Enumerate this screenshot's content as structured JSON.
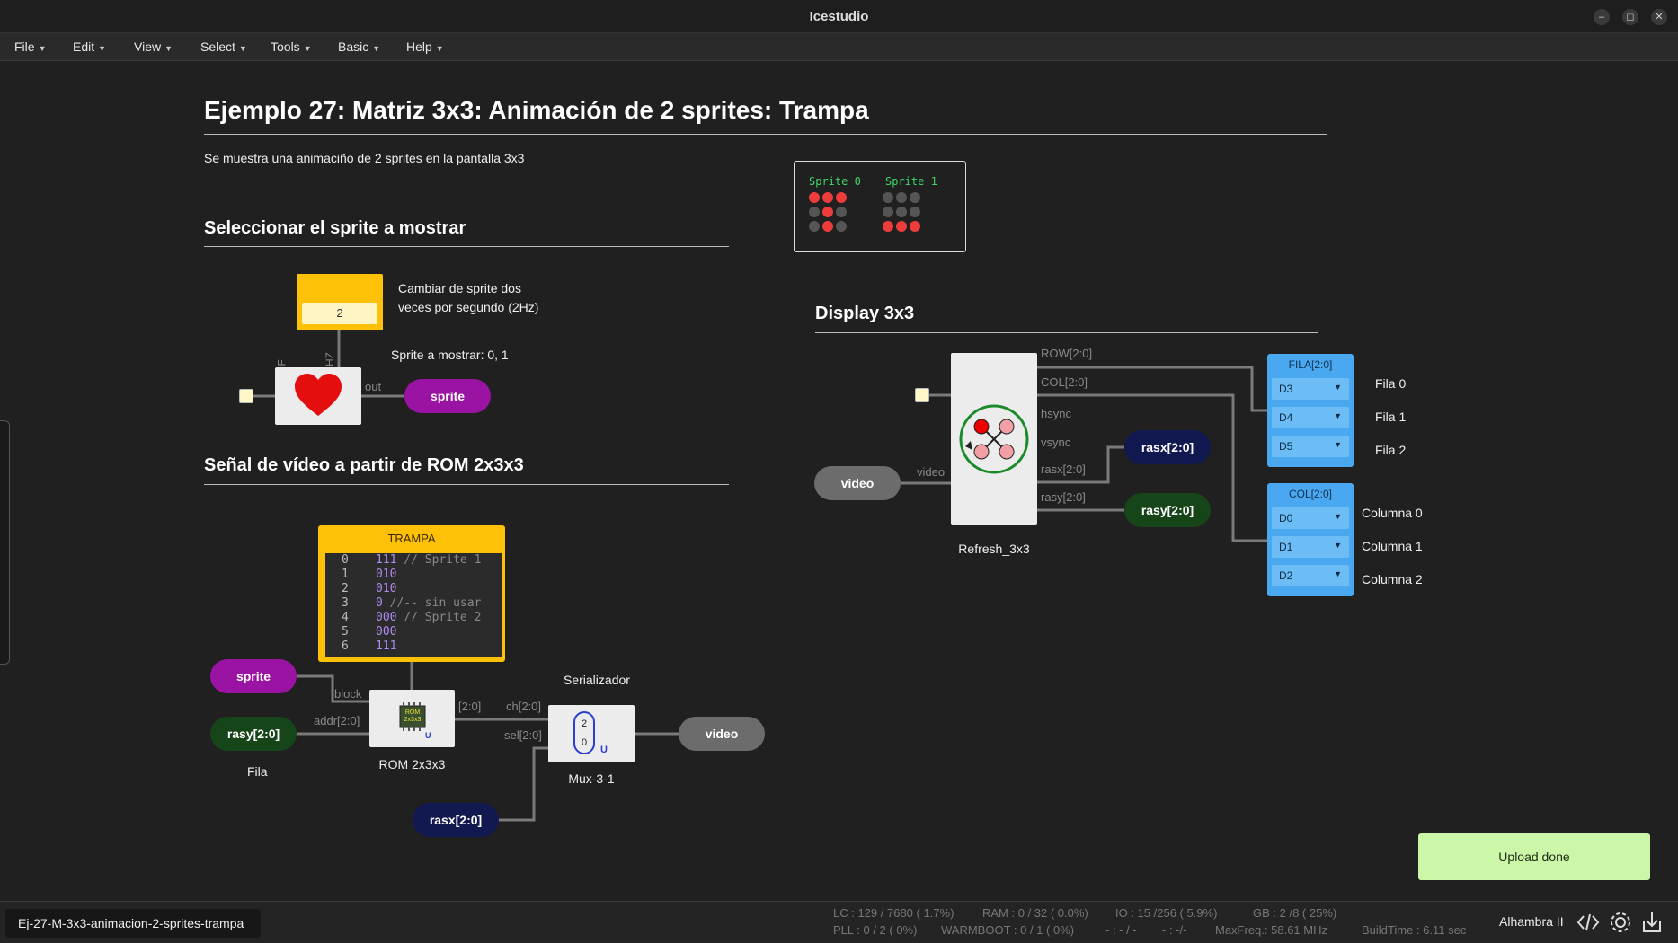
{
  "window": {
    "title": "Icestudio"
  },
  "menu": [
    "File",
    "Edit",
    "View",
    "Select",
    "Tools",
    "Basic",
    "Help"
  ],
  "canvas": {
    "title": "Ejemplo 27: Matriz 3x3: Animación de 2 sprites: Trampa",
    "description": "Se muestra una animaciño de 2 sprites en la pantalla 3x3",
    "section_select": "Seleccionar el sprite a mostrar",
    "section_video": "Señal de vídeo a partir de ROM 2x3x3",
    "section_display": "Display 3x3",
    "freq_value": "2",
    "freq_comment_1": "Cambiar de sprite dos",
    "freq_comment_2": "veces por segundo (2Hz)",
    "sprite_comment": "Sprite a mostrar: 0, 1",
    "heart_pins": {
      "f": "F",
      "hz": "HZ",
      "out": "out"
    },
    "sprite_label": "sprite",
    "sprite_preview": {
      "titles": [
        "Sprite 0",
        "Sprite 1"
      ],
      "sprite0": [
        [
          1,
          1,
          1
        ],
        [
          0,
          1,
          0
        ],
        [
          0,
          1,
          0
        ]
      ],
      "sprite1": [
        [
          0,
          0,
          0
        ],
        [
          0,
          0,
          0
        ],
        [
          1,
          1,
          1
        ]
      ]
    },
    "rom_memory": {
      "title": "TRAMPA",
      "lines": [
        {
          "n": "0",
          "code": "111",
          "comment": " // Sprite 1"
        },
        {
          "n": "1",
          "code": "010",
          "comment": ""
        },
        {
          "n": "2",
          "code": "010",
          "comment": ""
        },
        {
          "n": "3",
          "code": "0",
          "comment": " //-- sin usar"
        },
        {
          "n": "4",
          "code": "000",
          "comment": " // Sprite 2"
        },
        {
          "n": "5",
          "code": "000",
          "comment": ""
        },
        {
          "n": "6",
          "code": "111",
          "comment": ""
        }
      ]
    },
    "rom_block": {
      "label": "ROM 2x3x3",
      "in_block": "block",
      "in_addr": "addr[2:0]",
      "out": "[2:0]",
      "chip": "ROM 2x3x3",
      "u": "U"
    },
    "mux_block": {
      "label": "Mux-3-1",
      "title": "Serializador",
      "in_ch": "ch[2:0]",
      "in_sel": "sel[2:0]",
      "top": "2",
      "bottom": "0",
      "u": "U"
    },
    "video_pill": "video",
    "rasy_pill": "rasy[2:0]",
    "rasx_pill": "rasx[2:0]",
    "fila_comment": "Fila",
    "refresh_block": {
      "label": "Refresh_3x3",
      "in_video": "video",
      "out_row": "ROW[2:0]",
      "out_col": "COL[2:0]",
      "out_hsync": "hsync",
      "out_vsync": "vsync",
      "out_rasx": "rasx[2:0]",
      "out_rasy": "rasy[2:0]"
    },
    "fila_panel": {
      "title": "FILA[2:0]",
      "pins": [
        "D3",
        "D4",
        "D5"
      ],
      "labels": [
        "Fila 0",
        "Fila 1",
        "Fila 2"
      ]
    },
    "col_panel": {
      "title": "COL[2:0]",
      "pins": [
        "D0",
        "D1",
        "D2"
      ],
      "labels": [
        "Columna 0",
        "Columna 1",
        "Columna 2"
      ]
    }
  },
  "toast": "Upload done",
  "status": {
    "file": "Ej-27-M-3x3-animacion-2-sprites-trampa",
    "lc": "LC : 129 / 7680 ( 1.7%)",
    "ram": "RAM : 0 / 32 ( 0.0%)",
    "io": "IO : 15 /256 ( 5.9%)",
    "gb": "GB : 2 /8 ( 25%)",
    "pll": "PLL : 0 / 2 ( 0%)",
    "warmboot": "WARMBOOT : 0 / 1 ( 0%)",
    "dash1": "- : - / -",
    "dash2": "- : -/-",
    "maxfreq": "MaxFreq.: 58.61 MHz",
    "buildtime": "BuildTime : 6.11 sec",
    "board": "Alhambra II"
  },
  "colors": {
    "accent_yellow": "#ffc107",
    "panel_blue": "#4aa8f0",
    "toast_green": "#ccf6a8",
    "sprite_red": "#ee3c3c"
  }
}
